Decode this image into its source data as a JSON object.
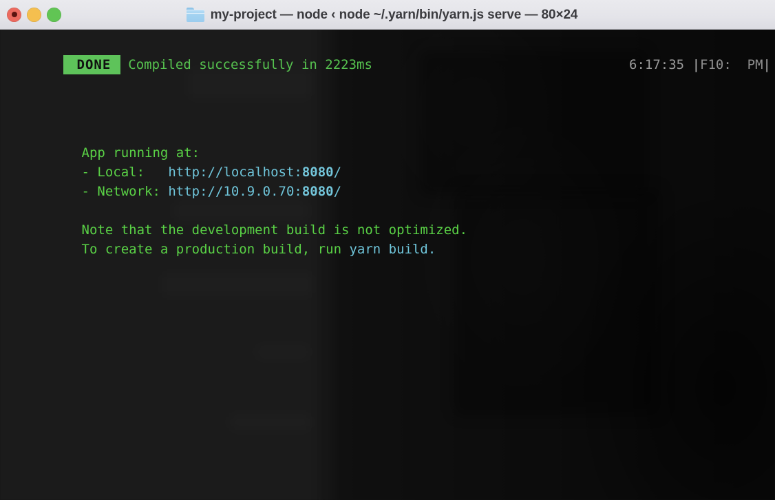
{
  "window": {
    "title": "my-project — node ‹ node ~/.yarn/bin/yarn.js serve — 80×24",
    "folder_icon": "folder-icon",
    "traffic_lights": {
      "close": "close-button",
      "minimize": "minimize-button",
      "zoom": "zoom-button"
    }
  },
  "terminal": {
    "columns": 80,
    "rows": 24,
    "status_line": {
      "badge": "DONE",
      "message": "Compiled successfully in 2223ms",
      "clock": "6:17:35",
      "right_marker_left": "|",
      "right_marker_text": "F10:  PM",
      "right_marker_right": "|"
    },
    "lines": {
      "app_running": "App running at:",
      "local_label": "- Local:   ",
      "local_url_prefix": "http://localhost:",
      "local_port": "8080",
      "local_url_suffix": "/",
      "network_label": "- Network: ",
      "network_url_prefix": "http://10.9.0.70:",
      "network_port": "8080",
      "network_url_suffix": "/",
      "note_line": "Note that the development build is not optimized.",
      "build_line_prefix": "To create a production build, run ",
      "build_command": "yarn build."
    }
  },
  "colors": {
    "badge_bg": "#5ec35a",
    "green_text": "#56c24f",
    "cyan_text": "#6fc5da",
    "gray_text": "#9a9a9a",
    "terminal_bg": "#141414",
    "titlebar_bg": "#e4e4e9"
  }
}
